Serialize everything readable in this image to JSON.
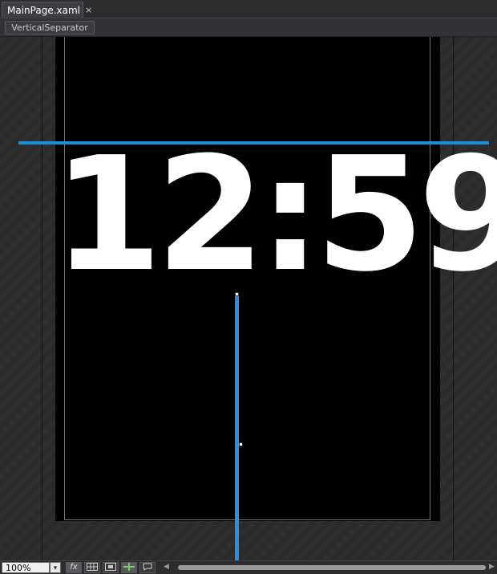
{
  "tabs": [
    {
      "label": "MainPage.xaml",
      "close": "×"
    }
  ],
  "breadcrumb": {
    "item": "VerticalSeparator"
  },
  "canvas": {
    "clock_text": "12:59"
  },
  "statusbar": {
    "zoom": "100%",
    "zoom_dropdown": "▾",
    "fx_label": "fx",
    "scroll_left": "◀",
    "scroll_right": "▶"
  },
  "colors": {
    "selection_accent": "#1a8fd8",
    "canvas_background": "#000000",
    "clock_text": "#ffffff"
  },
  "icons": [
    "close-icon",
    "fx-icon",
    "grid-icon",
    "snap-grid-icon",
    "snap-lines-icon",
    "annotation-icon"
  ]
}
